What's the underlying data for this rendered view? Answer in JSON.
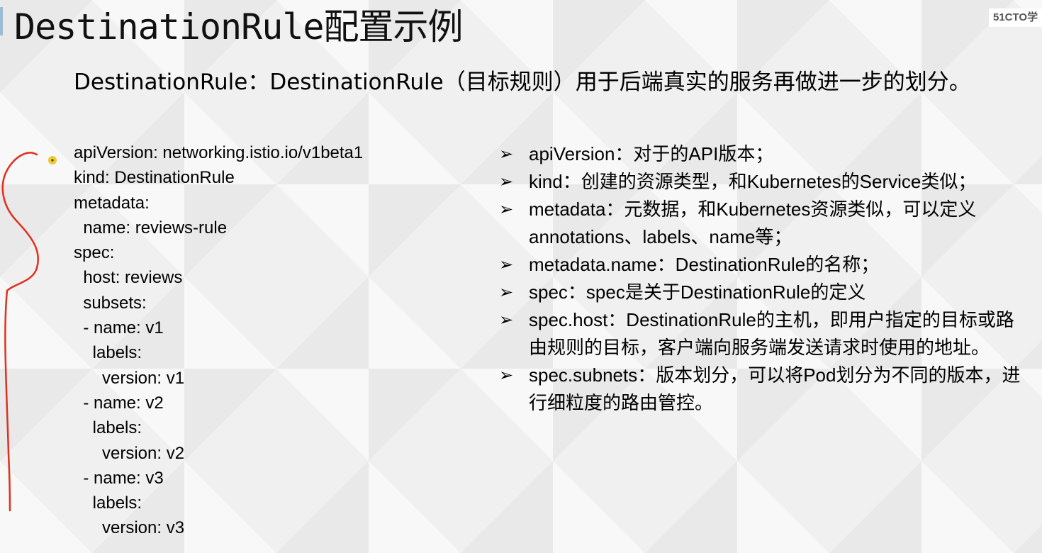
{
  "title": "DestinationRule配置示例",
  "logo": "51CTO学",
  "intro": "DestinationRule：DestinationRule（目标规则）用于后端真实的服务再做进一步的划分。",
  "code_lines": [
    "apiVersion: networking.istio.io/v1beta1",
    "kind: DestinationRule",
    "metadata:",
    "  name: reviews-rule",
    "spec:",
    "  host: reviews",
    "  subsets:",
    "  - name: v1",
    "    labels:",
    "      version: v1",
    "  - name: v2",
    "    labels:",
    "      version: v2",
    "  - name: v3",
    "    labels:",
    "      version: v3"
  ],
  "bullet_marker": "➢",
  "bullets": [
    "apiVersion：对于的API版本；",
    "kind：创建的资源类型，和Kubernetes的Service类似；",
    "metadata：元数据，和Kubernetes资源类似，可以定义annotations、labels、name等；",
    "metadata.name：DestinationRule的名称；",
    "spec：spec是关于DestinationRule的定义",
    "spec.host：DestinationRule的主机，即用户指定的目标或路由规则的目标，客户端向服务端发送请求时使用的地址。",
    "spec.subnets：版本划分，可以将Pod划分为不同的版本，进行细粒度的路由管控。"
  ],
  "colors": {
    "annotation_stroke": "#e0301e",
    "pointer_dot": "#e8c21a",
    "accent_bar": "#9bbcd6"
  }
}
